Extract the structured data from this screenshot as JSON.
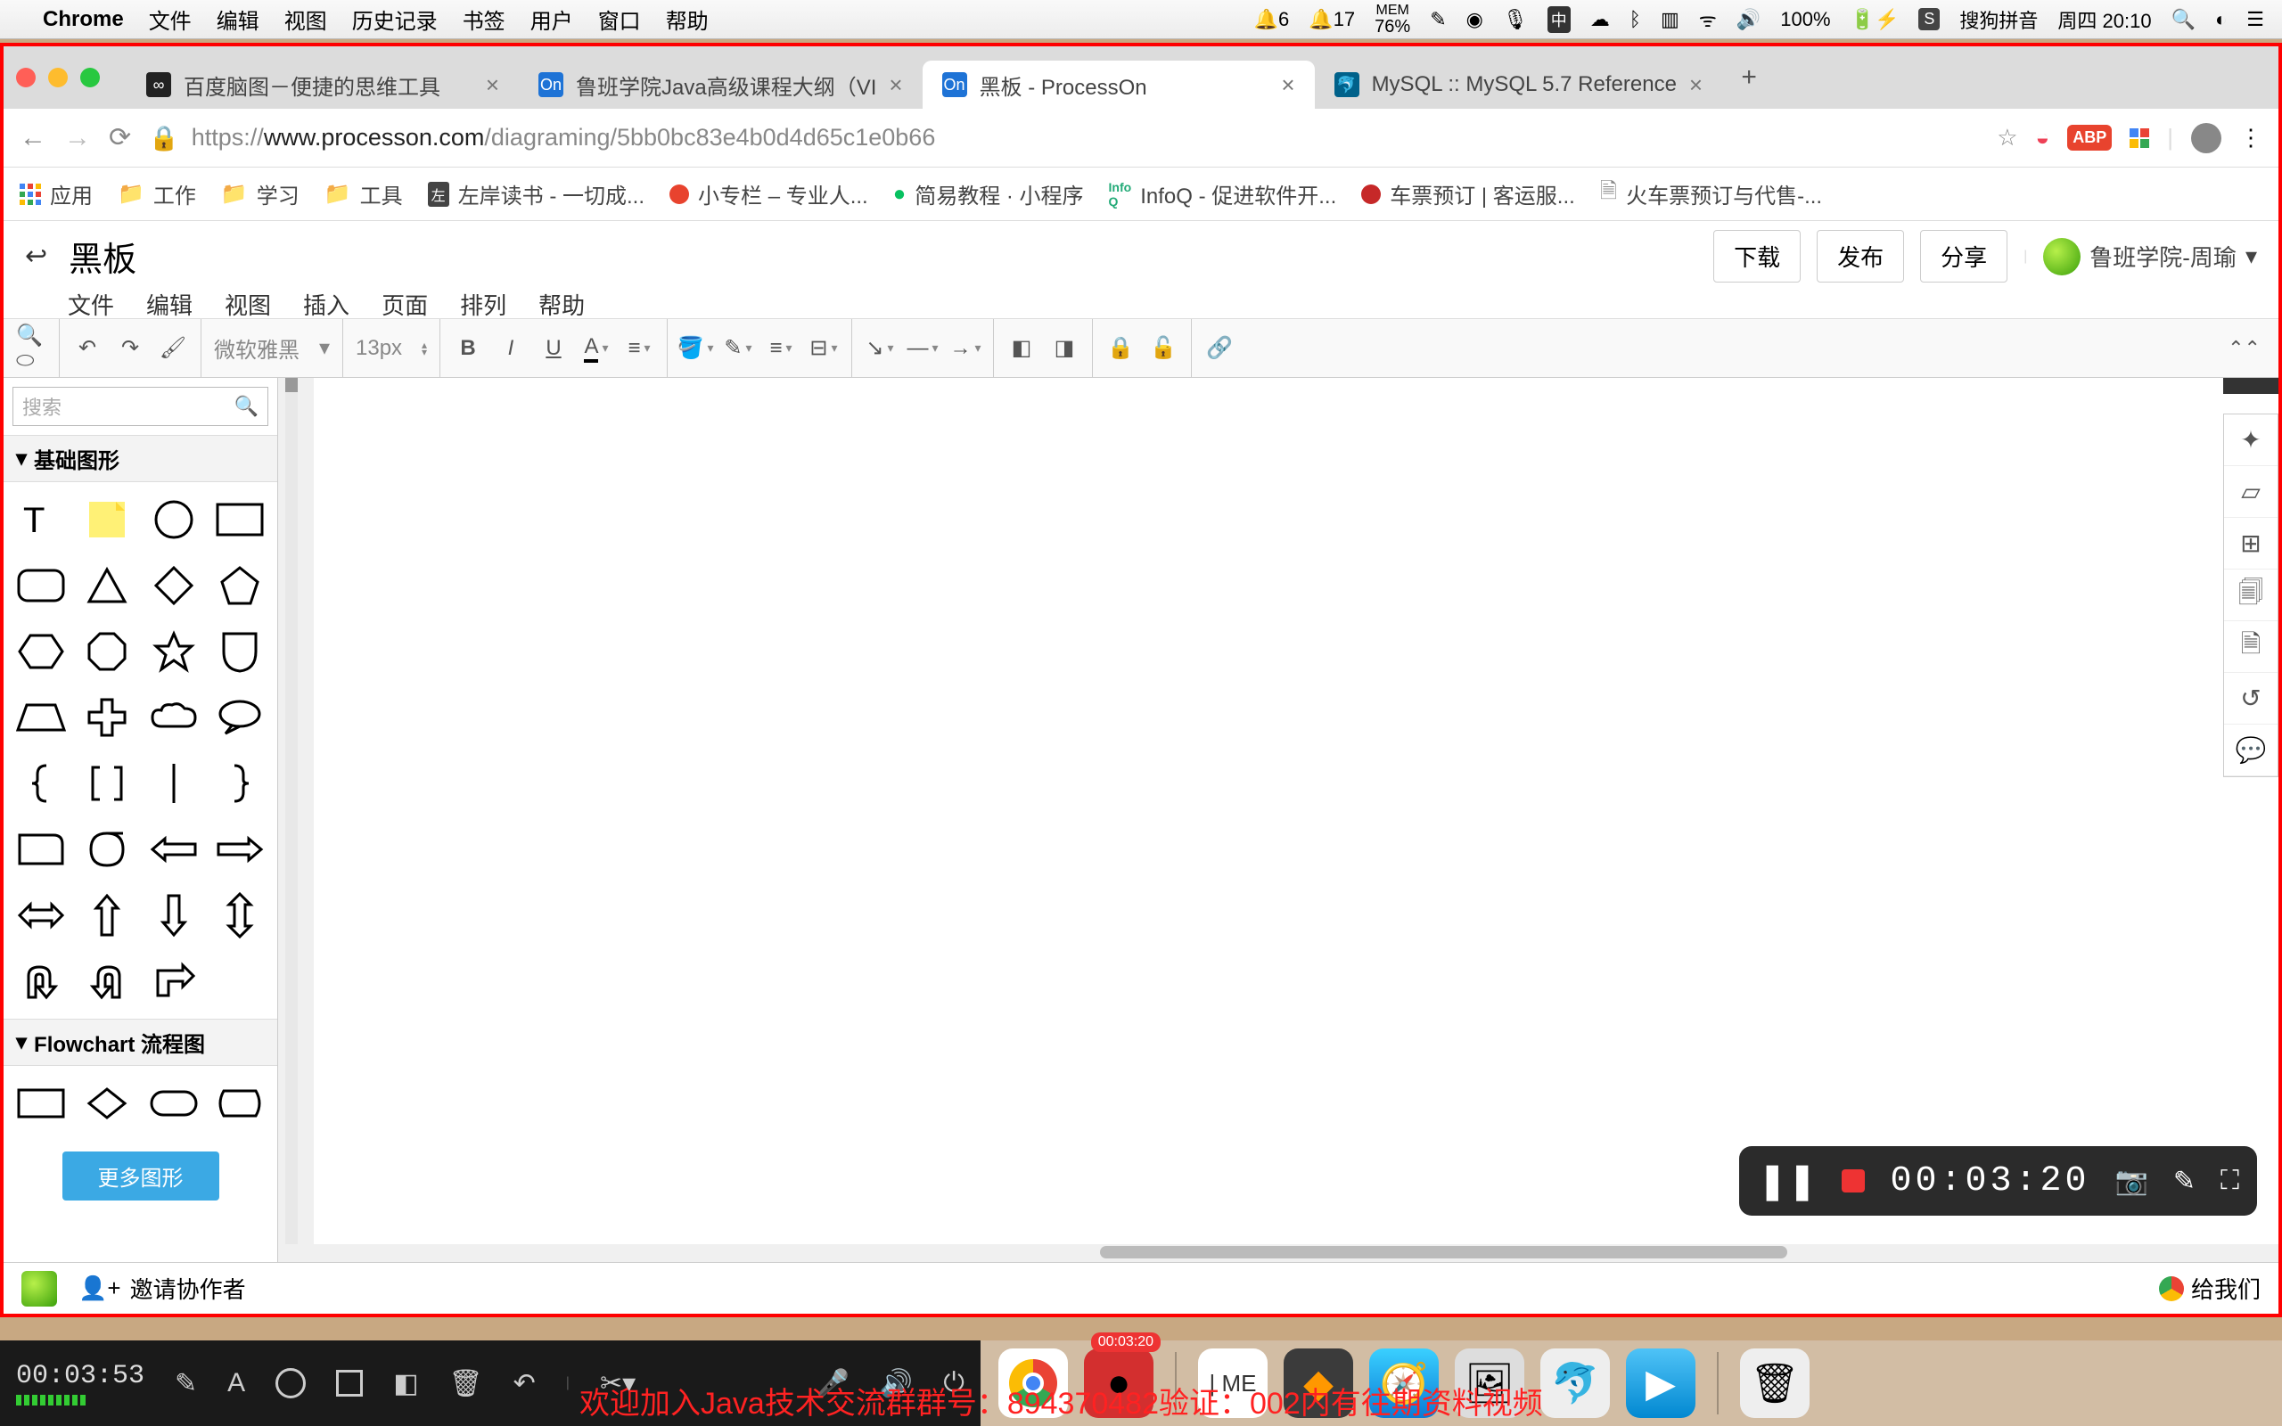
{
  "mac_menu": {
    "app": "Chrome",
    "items": [
      "文件",
      "编辑",
      "视图",
      "历史记录",
      "书签",
      "用户",
      "窗口",
      "帮助"
    ],
    "bell1": "6",
    "bell2": "17",
    "mem_label": "MEM",
    "mem_pct": "76%",
    "battery": "100%",
    "ime": "搜狗拼音",
    "date": "周四 20:10"
  },
  "tabs": [
    {
      "title": "百度脑图－便捷的思维工具",
      "fav": "bd"
    },
    {
      "title": "鲁班学院Java高级课程大纲（VI",
      "fav": "on"
    },
    {
      "title": "黑板 - ProcessOn",
      "fav": "on",
      "active": true
    },
    {
      "title": "MySQL :: MySQL 5.7 Reference",
      "fav": "my"
    }
  ],
  "address": {
    "lock": "🔒",
    "scheme": "https://",
    "host": "www.processon.com",
    "path": "/diagraming/5bb0bc83e4b0d4d65c1e0b66"
  },
  "bookmarks": [
    {
      "icon": "apps",
      "label": "应用"
    },
    {
      "icon": "folder",
      "label": "工作"
    },
    {
      "icon": "folder",
      "label": "学习"
    },
    {
      "icon": "folder",
      "label": "工具"
    },
    {
      "icon": "zs",
      "label": "左岸读书 - 一切成..."
    },
    {
      "icon": "red",
      "label": "小专栏 – 专业人..."
    },
    {
      "icon": "wx",
      "label": "简易教程 · 小程序"
    },
    {
      "icon": "iq",
      "label": "InfoQ - 促进软件开..."
    },
    {
      "icon": "tk",
      "label": "车票预订 | 客运服..."
    },
    {
      "icon": "doc",
      "label": "火车票预订与代售-..."
    }
  ],
  "app": {
    "title": "黑板",
    "menus": [
      "文件",
      "编辑",
      "视图",
      "插入",
      "页面",
      "排列",
      "帮助"
    ],
    "buttons": {
      "download": "下载",
      "publish": "发布",
      "share": "分享"
    },
    "user": "鲁班学院-周瑜"
  },
  "toolbar": {
    "font": "微软雅黑",
    "size": "13px"
  },
  "sidebar": {
    "search_placeholder": "搜索",
    "cat_basic": "基础图形",
    "cat_flowchart": "Flowchart 流程图",
    "more": "更多图形"
  },
  "bottom": {
    "invite": "邀请协作者",
    "feedback": "给我们"
  },
  "recorder_overlay": {
    "time": "00:03:20"
  },
  "recorder_bar": {
    "time": "00:03:53",
    "dock_badge": "00:03:20"
  },
  "marquee": "欢迎加入Java技术交流群群号：894370482验证：002内有往期资料视频"
}
